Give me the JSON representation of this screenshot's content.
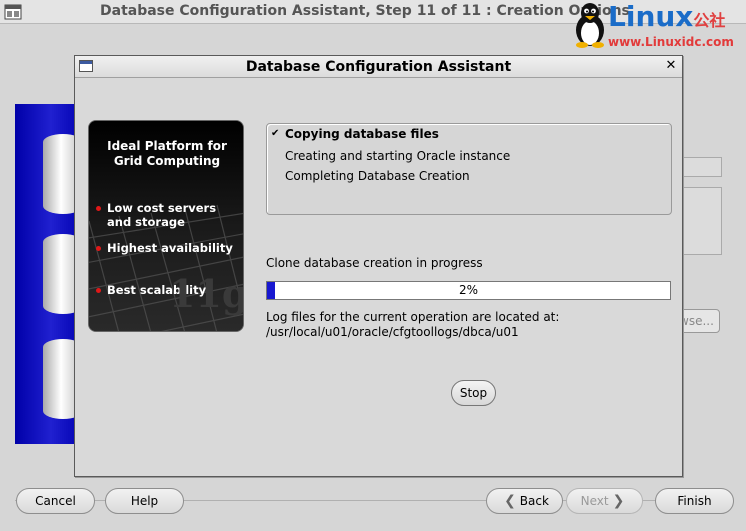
{
  "background_window": {
    "title": "Database Configuration Assistant, Step 11 of 11 : Creation Options",
    "browse_fragment": "wse...",
    "buttons": {
      "cancel": "Cancel",
      "help": "Help",
      "back": "Back",
      "next": "Next",
      "finish": "Finish"
    }
  },
  "watermark": {
    "brand": "Linux",
    "brand_cn": "公社",
    "url": "www.Linuxidc.com"
  },
  "dialog": {
    "title": "Database Configuration Assistant",
    "promo": {
      "heading": "Ideal Platform for Grid Computing",
      "bullets": [
        "Low cost servers and storage",
        "Highest availability",
        "Best scalability"
      ],
      "badge_text": "11g"
    },
    "steps": [
      {
        "label": "Copying database files",
        "state": "in-progress"
      },
      {
        "label": "Creating and starting Oracle instance",
        "state": "pending"
      },
      {
        "label": "Completing Database Creation",
        "state": "pending"
      }
    ],
    "progress": {
      "label": "Clone database creation in progress",
      "percent_text": "2%",
      "fraction": 0.02
    },
    "log": {
      "label": "Log files for the current operation are located at:",
      "path": "/usr/local/u01/oracle/cfgtoollogs/dbca/u01"
    },
    "stop_label": "Stop"
  },
  "colors": {
    "progress_fill": "#1818d0",
    "bullet_red": "#e01818",
    "banner_blue": "#1010c0"
  }
}
